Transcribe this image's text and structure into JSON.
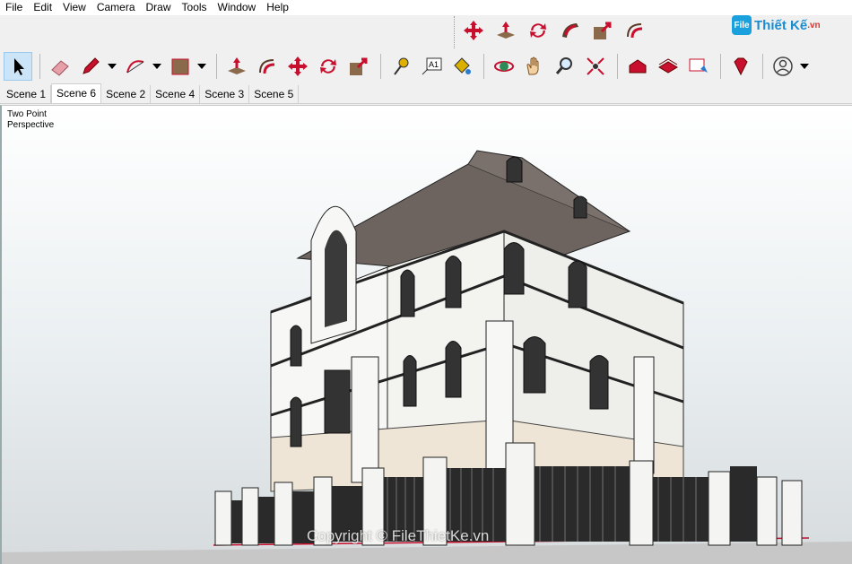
{
  "menubar": {
    "items": [
      "File",
      "Edit",
      "View",
      "Camera",
      "Draw",
      "Tools",
      "Window",
      "Help"
    ]
  },
  "logo": {
    "mark": "File",
    "text": "Thiết Kế",
    "suffix": ".vn"
  },
  "scene_tabs": [
    "Scene 1",
    "Scene 6",
    "Scene 2",
    "Scene 4",
    "Scene 3",
    "Scene 5"
  ],
  "active_tab": "Scene 6",
  "viewport": {
    "camera_mode_line1": "Two Point",
    "camera_mode_line2": "Perspective",
    "watermark": "Copyright © FileThietKe.vn"
  },
  "colors": {
    "accent_red": "#c8102e",
    "select_blue": "#cce4f7",
    "sky_top": "#ffffff",
    "ground": "#c8c8c8"
  },
  "floating_tools": [
    "move-icon",
    "push-pull-icon",
    "rotate-icon",
    "follow-me-icon",
    "scale-icon",
    "offset-icon"
  ],
  "main_tools": [
    "select-icon",
    "eraser-icon",
    "pencil-icon",
    "arc-icon",
    "rectangle-icon",
    "push-pull-icon",
    "offset-icon",
    "move-icon",
    "rotate-icon",
    "scale-icon",
    "tape-measure-icon",
    "text-icon",
    "paint-bucket-icon",
    "orbit-icon",
    "pan-icon",
    "zoom-icon",
    "zoom-extents-icon",
    "warehouse-icon",
    "extension-warehouse-icon",
    "layout-icon",
    "ruby-icon",
    "account-icon"
  ],
  "text_tool_label": "A1"
}
